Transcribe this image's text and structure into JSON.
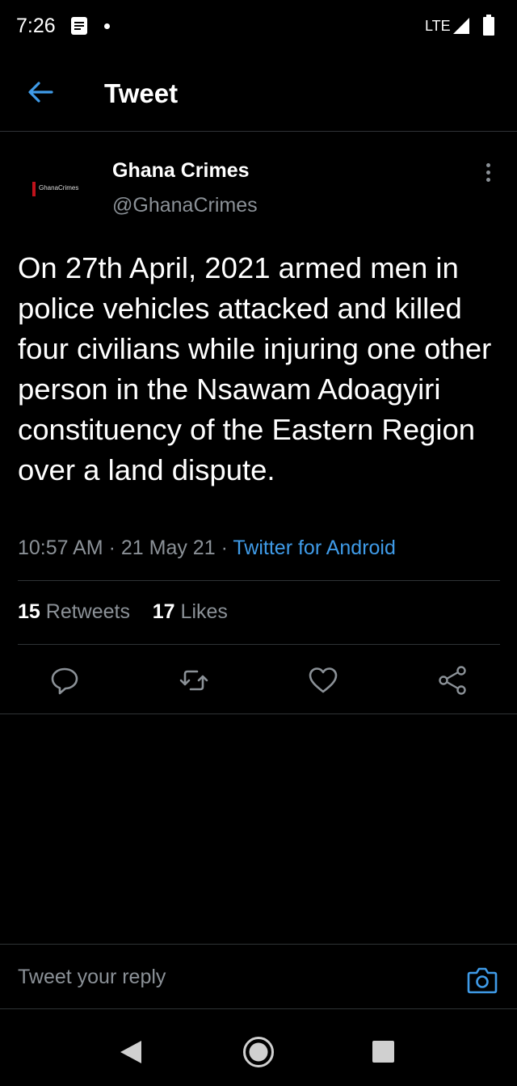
{
  "status_bar": {
    "time": "7:26",
    "network": "LTE"
  },
  "header": {
    "title": "Tweet"
  },
  "tweet": {
    "avatar_text": "GhanaCrimes",
    "author_name": "Ghana Crimes",
    "author_handle": "@GhanaCrimes",
    "text": "On 27th April, 2021 armed men in police vehicles attacked and killed four civilians while injuring one other person in the Nsawam Adoagyiri constituency of the Eastern Region over a land dispute.",
    "time": "10:57 AM",
    "date": "21 May 21",
    "separator": "·",
    "source": "Twitter for Android",
    "retweets_count": "15",
    "retweets_label": "Retweets",
    "likes_count": "17",
    "likes_label": "Likes"
  },
  "actions": {
    "icons": [
      "reply-icon",
      "retweet-icon",
      "like-icon",
      "share-icon"
    ]
  },
  "reply_bar": {
    "placeholder": "Tweet your reply"
  },
  "colors": {
    "background": "#000000",
    "accent": "#3f9be8",
    "secondary_text": "#8b9197",
    "divider": "#2f3336"
  }
}
